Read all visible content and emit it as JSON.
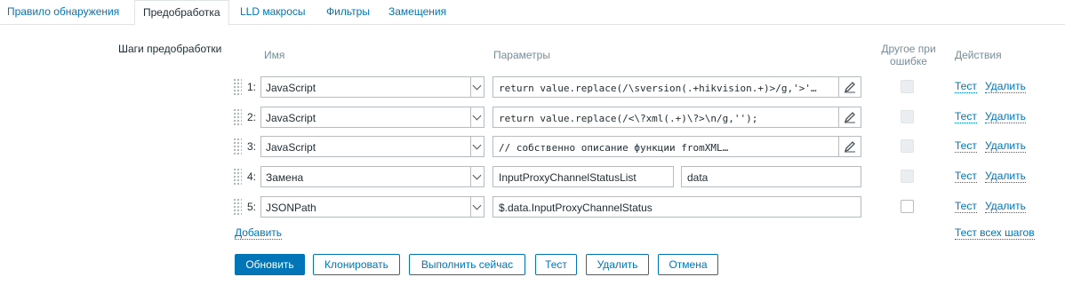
{
  "tabs": [
    {
      "label": "Правило обнаружения"
    },
    {
      "label": "Предобработка",
      "active": true
    },
    {
      "label": "LLD макросы"
    },
    {
      "label": "Фильтры"
    },
    {
      "label": "Замещения"
    }
  ],
  "section_label": "Шаги предобработки",
  "columns": {
    "name": "Имя",
    "params": "Параметры",
    "on_error_line1": "Другое при",
    "on_error_line2": "ошибке",
    "actions": "Действия"
  },
  "steps": [
    {
      "num": "1:",
      "type": "JavaScript",
      "param1": "return value.replace(/\\sversion(.+hikvision.+)>/g,'>'…",
      "test": "Тест",
      "delete": "Удалить"
    },
    {
      "num": "2:",
      "type": "JavaScript",
      "param1": "return value.replace(/<\\?xml(.+)\\?>\\n/g,'');",
      "test": "Тест",
      "delete": "Удалить"
    },
    {
      "num": "3:",
      "type": "JavaScript",
      "param1": "// собственно описание функции fromXML…",
      "test": "Тест",
      "delete": "Удалить"
    },
    {
      "num": "4:",
      "type": "Замена",
      "param1": "InputProxyChannelStatusList",
      "param2": "data",
      "test": "Тест",
      "delete": "Удалить"
    },
    {
      "num": "5:",
      "type": "JSONPath",
      "param1": "$.data.InputProxyChannelStatus",
      "test": "Тест",
      "delete": "Удалить"
    }
  ],
  "add_link": "Добавить",
  "test_all_link": "Тест всех шагов",
  "buttons": {
    "update": "Обновить",
    "clone": "Клонировать",
    "execute_now": "Выполнить сейчас",
    "test": "Тест",
    "delete": "Удалить",
    "cancel": "Отмена"
  },
  "colors": {
    "accent": "#0275b8",
    "text": "#1f2c33",
    "muted": "#768d99",
    "border": "#b4bcc2"
  }
}
